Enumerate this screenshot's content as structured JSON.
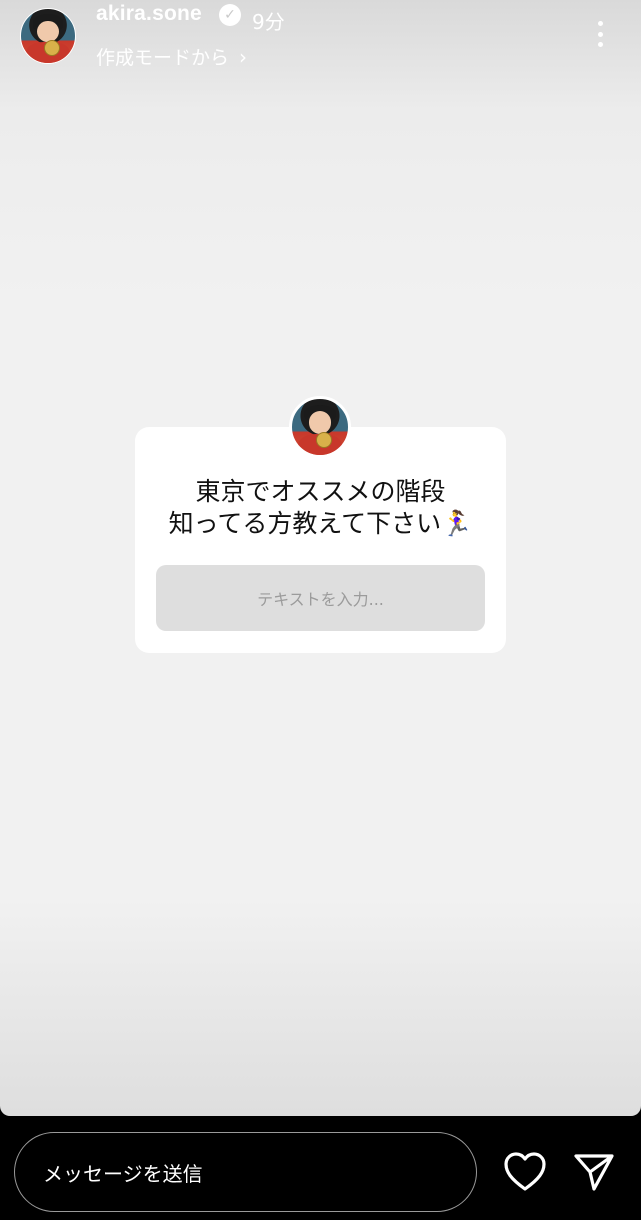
{
  "header": {
    "username": "akira.sone",
    "verified_icon": "verified-badge-icon",
    "time": "9分",
    "subtitle": "作成モードから",
    "subtitle_icon": "chevron-right-icon",
    "more_icon": "more-vertical-icon"
  },
  "sticker": {
    "question": "東京でオススメの階段\n知ってる方教えて下さい🏃‍♀️",
    "answer_placeholder": "テキストを入力..."
  },
  "footer": {
    "message_placeholder": "メッセージを送信",
    "like_icon": "heart-icon",
    "send_icon": "send-icon"
  }
}
